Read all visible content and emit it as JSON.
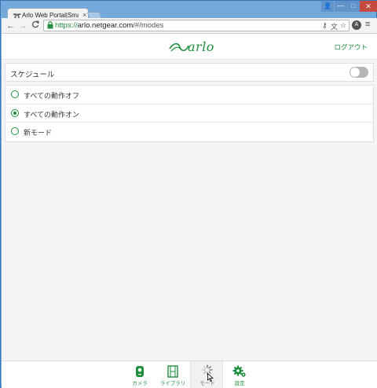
{
  "browser": {
    "tab_title": "Arlo Web Portal|Smart",
    "tab_close": "×",
    "url_scheme": "https://",
    "url_host": "arlo.netgear.com",
    "url_path": "/#/modes",
    "back_icon": "←",
    "forward_icon": "→",
    "reload_icon": "C",
    "lock_icon": "🔒",
    "key_icon": "⚷",
    "translate_icon": "文",
    "star_icon": "☆",
    "extension_icon": "A",
    "menu_icon": "≡",
    "window_user_icon": "👤",
    "window_min": "—",
    "window_max": "□",
    "window_close": "✕"
  },
  "header": {
    "logo_text": "arlo",
    "logout_label": "ログアウト"
  },
  "schedule": {
    "label": "スケジュール",
    "enabled": false
  },
  "modes": [
    {
      "label": "すべての動作オフ",
      "selected": false
    },
    {
      "label": "すべての動作オン",
      "selected": true
    },
    {
      "label": "新モード",
      "selected": false
    }
  ],
  "bottom_nav": [
    {
      "label": "カメラ",
      "icon": "camera-icon",
      "active": false
    },
    {
      "label": "ライブラリ",
      "icon": "film-library-icon",
      "active": false
    },
    {
      "label": "モード",
      "icon": "loading-spinner-icon",
      "active": true
    },
    {
      "label": "設定",
      "icon": "gears-icon",
      "active": false
    }
  ],
  "colors": {
    "brand_green": "#1f8f3d",
    "toggle_off": "#b5b5b5",
    "page_background": "#f4f4f4"
  }
}
